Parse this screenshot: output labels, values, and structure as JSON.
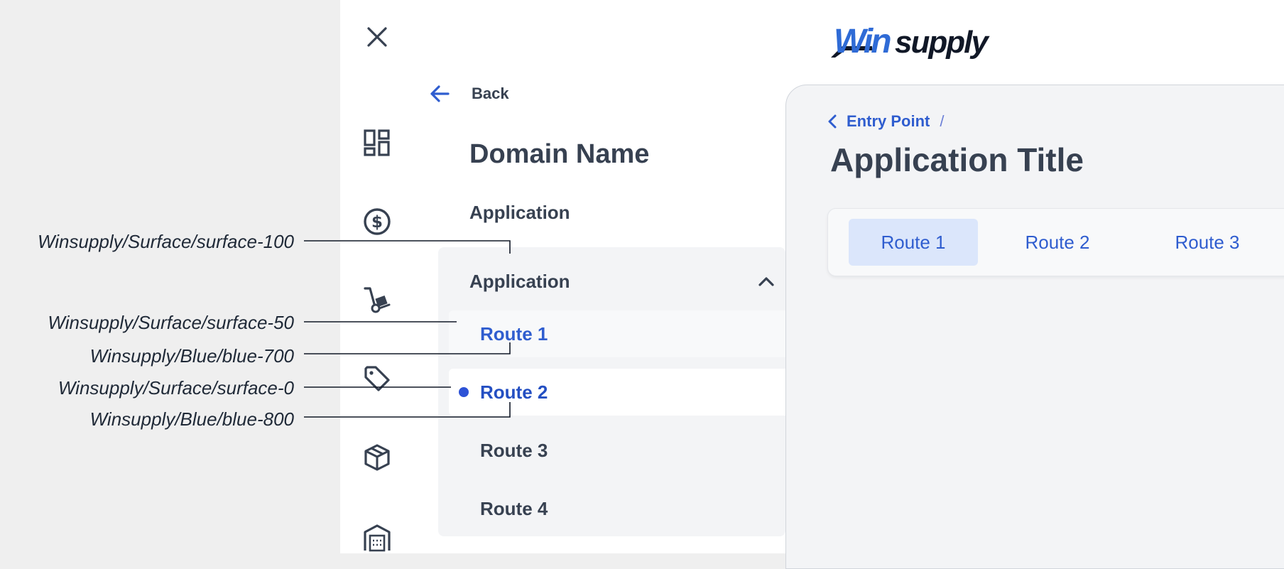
{
  "annotations": [
    {
      "label": "Winsupply/Surface/surface-100"
    },
    {
      "label": "Winsupply/Surface/surface-50"
    },
    {
      "label": "Winsupply/Blue/blue-700"
    },
    {
      "label": "Winsupply/Surface/surface-0"
    },
    {
      "label": "Winsupply/Blue/blue-800"
    }
  ],
  "nav": {
    "back_label": "Back",
    "domain_name": "Domain Name",
    "application_label": "Application",
    "group": {
      "label": "Application",
      "expanded": true,
      "routes": [
        {
          "label": "Route 1",
          "state": "hover"
        },
        {
          "label": "Route 2",
          "state": "selected"
        },
        {
          "label": "Route 3",
          "state": "default"
        },
        {
          "label": "Route 4",
          "state": "default"
        }
      ]
    },
    "rail_icons": [
      "dashboard-icon",
      "dollar-icon",
      "hand-truck-icon",
      "tag-icon",
      "box-icon",
      "warehouse-icon"
    ]
  },
  "header": {
    "logo_text": {
      "win": "Win",
      "supply": "supply"
    }
  },
  "content": {
    "breadcrumb": {
      "link": "Entry Point",
      "separator": "/"
    },
    "title": "Application Title",
    "tabs": [
      {
        "label": "Route 1",
        "active": true
      },
      {
        "label": "Route 2",
        "active": false
      },
      {
        "label": "Route 3",
        "active": false
      }
    ]
  },
  "colors": {
    "surface_100": "#f3f4f6",
    "surface_50": "#f8f9fa",
    "surface_0": "#ffffff",
    "blue_700": "#2f5dcf",
    "blue_800": "#244fc2",
    "text": "#374151",
    "logo_blue": "#2f6bd6"
  }
}
